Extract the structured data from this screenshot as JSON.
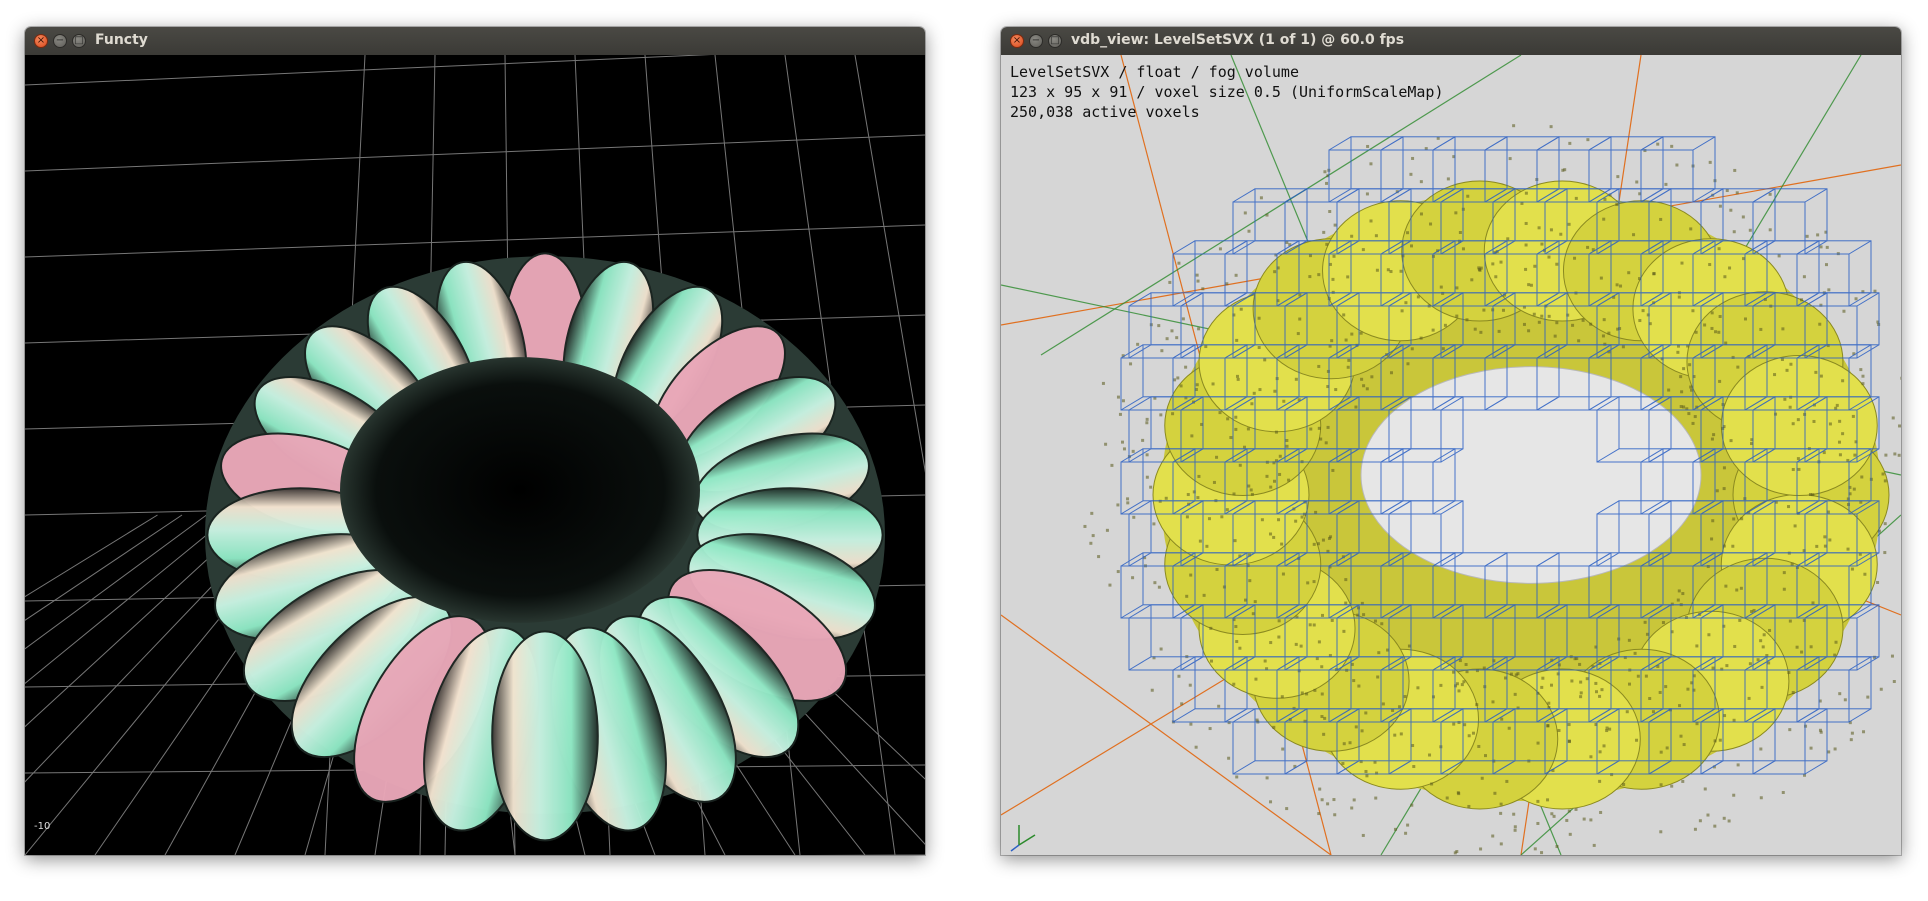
{
  "windows": {
    "functy": {
      "title": "Functy",
      "axis_label": "-10",
      "colors": {
        "background": "#000000",
        "grid": "#d8d8d8",
        "surface_a": "#8ee8c4",
        "surface_b": "#f2e3cf",
        "surface_c": "#e9a7b8"
      }
    },
    "vdb": {
      "title": "vdb_view: LevelSetSVX (1 of 1) @ 60.0 fps",
      "info": {
        "line1": "LevelSetSVX / float / fog volume",
        "line2": "123 x 95 x 91 / voxel size 0.5 (UniformScaleMap)",
        "line3": "250,038 active voxels"
      },
      "colors": {
        "background": "#d6d6d6",
        "voxels": "#e2e04c",
        "wireframe": "#2a5fc4",
        "axis_x": "#e07020",
        "axis_y": "#2c8a2c"
      }
    }
  }
}
